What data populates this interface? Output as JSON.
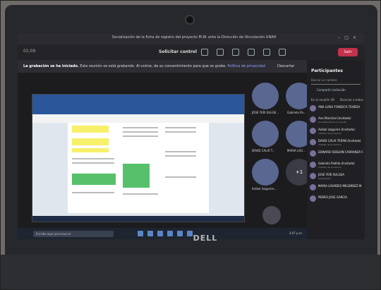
{
  "meeting": {
    "window_title": "Socialización de la ficha de registro del proyecto M.W. ante la Dirección de Vinculación UNAH",
    "toolbar_left": "01:09",
    "toolbar_center": "Solicitar control",
    "leave_label": "Salir"
  },
  "banner": {
    "bold": "La grabación se ha iniciado.",
    "text": "Esta reunión se está grabando. Al unirse, da su consentimiento para que se grabe.",
    "link": "Política de privacidad",
    "dismiss": "Descartar"
  },
  "participants": {
    "title": "Participantes",
    "search_placeholder": "Buscar un nombre",
    "share_invite": "Compartir invitación",
    "section": "En la reunión (9)",
    "mute_all": "Silenciar a todos",
    "items": [
      {
        "name": "ANA LUISA FONSECA TEHEDA",
        "sub": ""
      },
      {
        "name": "Ana Marichal (Invitado)",
        "sub": "Accesibilidad de la reunión"
      },
      {
        "name": "Anibal izaguirre (Invitado)",
        "sub": "Invitado de la reunión"
      },
      {
        "name": "DAVID CALIX TERAN (Invitado)",
        "sub": "Invitado de la reunión"
      },
      {
        "name": "EDWARD ODELVIN CARRANZA F.",
        "sub": ""
      },
      {
        "name": "Gabriela Padilla (Invitado)",
        "sub": "Invitado de la reunión"
      },
      {
        "name": "JOSE YERI SULGEA",
        "sub": "Organizador"
      },
      {
        "name": "MARIA LOURDES MELENDEZ M.",
        "sub": ""
      },
      {
        "name": "PEDRO JOSE GARCIA",
        "sub": ""
      }
    ]
  },
  "tiles": [
    {
      "label": "JOSE YERI SULGE..."
    },
    {
      "label": "Gabriela Pa..."
    },
    {
      "label": "DAVID CALIX T..."
    },
    {
      "label": "MARIA LOU..."
    },
    {
      "label": "Anibal izaguirre..."
    },
    {
      "label": "+1"
    }
  ],
  "taskbar": {
    "search": "Escribe aquí para buscar",
    "clock": "3:07 p.m."
  },
  "hardware": {
    "brand": "DELL"
  }
}
